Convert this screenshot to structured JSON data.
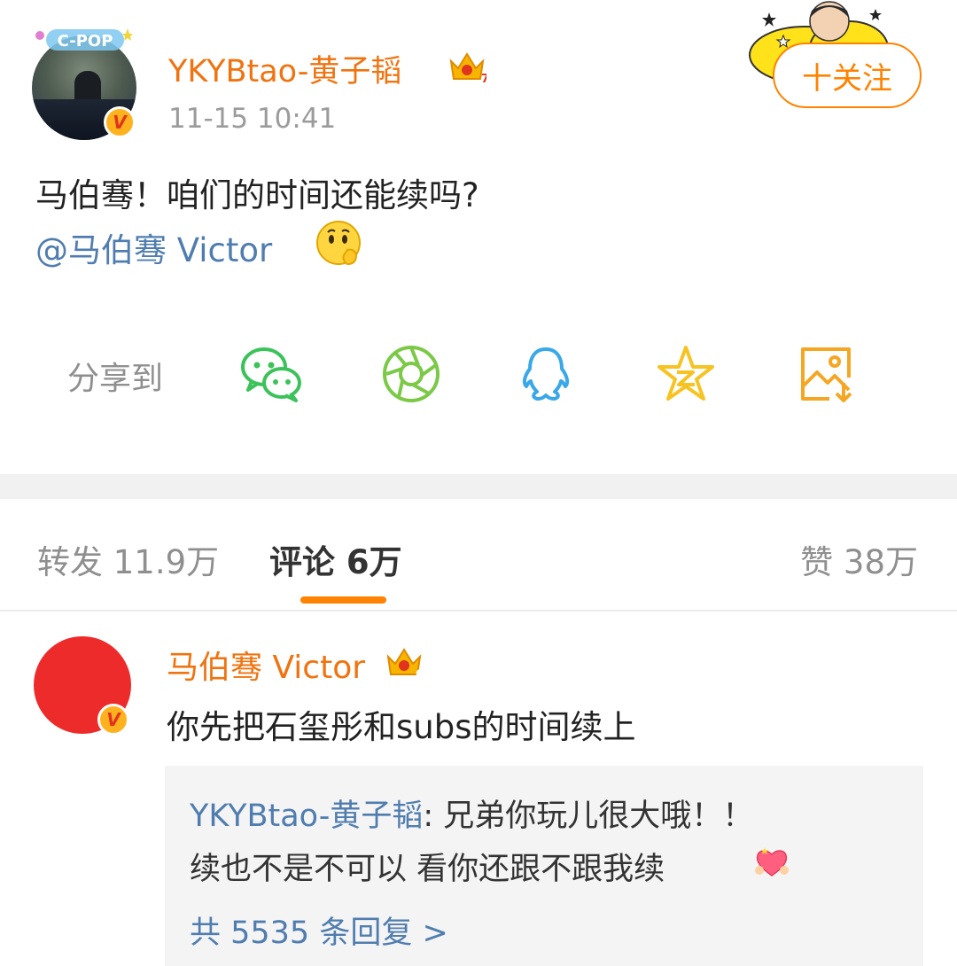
{
  "post": {
    "username": "YKYBtao-黄子韬",
    "crown_level": "7",
    "avatar_badge": "V",
    "avatar_sticker_text": "C-POP",
    "timestamp": "11-15 10:41",
    "text": "马伯骞！咱们的时间还能续吗?",
    "mention": "@马伯骞 Victor",
    "mention_emoji": "thinking-face-emoji",
    "follow_label": "十关注"
  },
  "share": {
    "label": "分享到",
    "icons": [
      "wechat-icon",
      "moments-icon",
      "qq-icon",
      "qzone-icon",
      "save-image-icon"
    ],
    "colors": {
      "wechat": "#3cc25a",
      "moments": "#7bc947",
      "qq": "#3aa8e8",
      "qzone": "#f7c322",
      "save": "#f5a623"
    }
  },
  "tabs": {
    "repost": "转发 11.9万",
    "comments": "评论 6万",
    "likes": "赞 38万"
  },
  "comment": {
    "username": "马伯骞 Victor",
    "crown_level": "6",
    "avatar_badge": "V",
    "text": "你先把石玺彤和subs的时间续上",
    "reply": {
      "username": "YKYBtao-黄子韬",
      "separator": ": ",
      "line1_text": "兄弟你玩儿很大哦！！",
      "line2_text": "续也不是不可以 看你还跟不跟我续",
      "emoji": "heart-emoji",
      "count_label": "共 5535 条回复 >"
    }
  },
  "colors": {
    "accent_orange": "#ff8200",
    "username_orange": "#f0730f",
    "link_blue": "#507daf",
    "muted_gray": "#8f8f8f"
  }
}
